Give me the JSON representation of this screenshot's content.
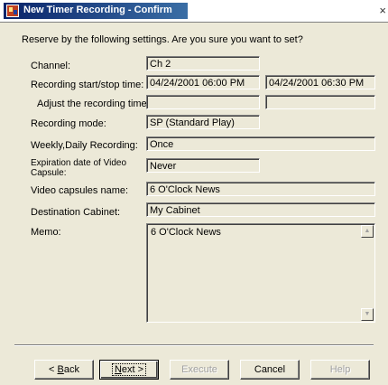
{
  "window": {
    "title": "New Timer Recording - Confirm",
    "close_label": "×"
  },
  "prompt": "Reserve by the following settings. Are you sure you want to set?",
  "fields": {
    "channel": {
      "label": "Channel:",
      "value": "Ch 2"
    },
    "start_stop": {
      "label": "Recording start/stop time:",
      "start": "04/24/2001 06:00 PM",
      "stop": "04/24/2001 06:30 PM"
    },
    "adjust": {
      "label": "Adjust the recording time:",
      "start": "",
      "stop": ""
    },
    "mode": {
      "label": "Recording mode:",
      "value": "SP (Standard Play)"
    },
    "weekly": {
      "label": "Weekly,Daily Recording:",
      "value": "Once"
    },
    "expiration": {
      "label": "Expiration date of Video Capsule:",
      "value": "Never"
    },
    "capsule_name": {
      "label": "Video capsules name:",
      "value": "6 O'Clock News"
    },
    "cabinet": {
      "label": "Destination Cabinet:",
      "value": "My Cabinet"
    },
    "memo": {
      "label": "Memo:",
      "value": "6 O'Clock News"
    }
  },
  "buttons": {
    "back": {
      "prefix": "< ",
      "mnemonic": "B",
      "rest": "ack"
    },
    "next": {
      "mnemonic": "N",
      "rest": "ext >"
    },
    "execute": "Execute",
    "cancel": "Cancel",
    "help": "Help"
  },
  "icons": {
    "app": "app-icon",
    "scroll_up": "scroll-up-icon",
    "scroll_down": "scroll-down-icon"
  }
}
